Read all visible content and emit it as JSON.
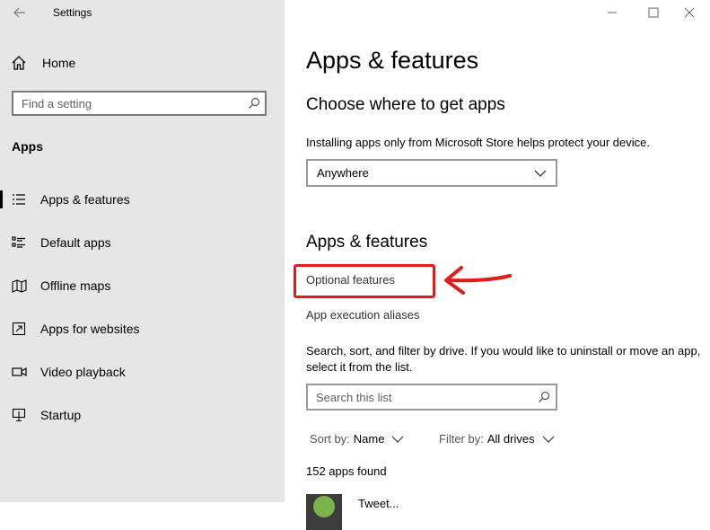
{
  "window": {
    "title": "Settings",
    "controls": {
      "minimize": "minimize-icon",
      "maximize": "maximize-icon",
      "close": "close-icon"
    }
  },
  "sidebar": {
    "home_label": "Home",
    "search_placeholder": "Find a setting",
    "section_label": "Apps",
    "items": [
      {
        "label": "Apps & features",
        "icon": "apps-features-icon",
        "active": true
      },
      {
        "label": "Default apps",
        "icon": "default-apps-icon",
        "active": false
      },
      {
        "label": "Offline maps",
        "icon": "offline-maps-icon",
        "active": false
      },
      {
        "label": "Apps for websites",
        "icon": "apps-for-websites-icon",
        "active": false
      },
      {
        "label": "Video playback",
        "icon": "video-playback-icon",
        "active": false
      },
      {
        "label": "Startup",
        "icon": "startup-icon",
        "active": false
      }
    ]
  },
  "main": {
    "page_title": "Apps & features",
    "choose_heading": "Choose where to get apps",
    "choose_desc": "Installing apps only from Microsoft Store helps protect your device.",
    "source_dropdown_value": "Anywhere",
    "features_heading": "Apps & features",
    "optional_features_link": "Optional features",
    "app_execution_aliases_link": "App execution aliases",
    "list_desc": "Search, sort, and filter by drive. If you would like to uninstall or move an app, select it from the list.",
    "list_search_placeholder": "Search this list",
    "sort_label": "Sort by:",
    "sort_value": "Name",
    "filter_label": "Filter by:",
    "filter_value": "All drives",
    "apps_found": "152 apps found",
    "first_app_name": "Tweet..."
  },
  "annotation": {
    "color": "#e31b1b",
    "target": "Optional features"
  },
  "colors": {
    "sidebar_bg": "#e6e6e6",
    "main_bg": "#ffffff"
  }
}
